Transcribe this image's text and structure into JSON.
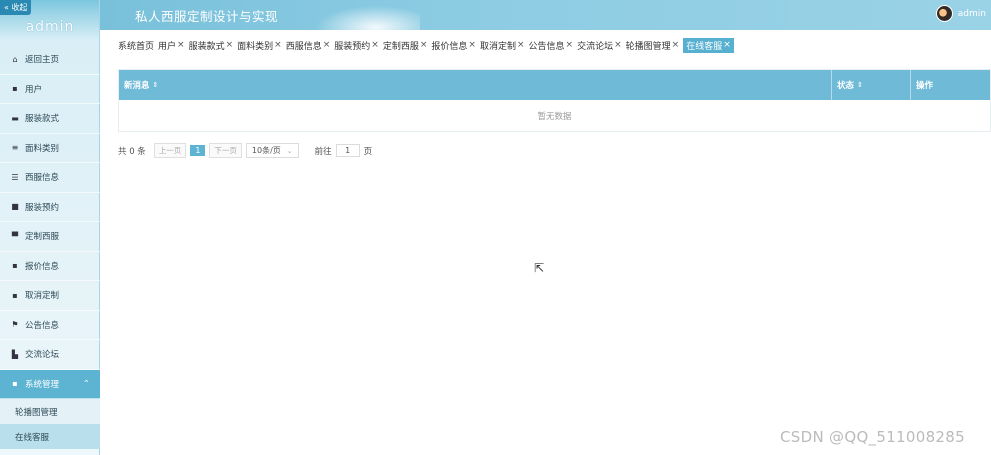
{
  "sidebar": {
    "collapse_label": "« 收起",
    "brand": "admin",
    "items": [
      {
        "label": "返回主页",
        "icon": "home-icon",
        "glyph": "⌂"
      },
      {
        "label": "用户",
        "icon": "grid-icon",
        "glyph": "▪"
      },
      {
        "label": "服装款式",
        "icon": "briefcase-icon",
        "glyph": "▬"
      },
      {
        "label": "面料类别",
        "icon": "list-icon",
        "glyph": "≡"
      },
      {
        "label": "西服信息",
        "icon": "sliders-icon",
        "glyph": "☰"
      },
      {
        "label": "服装预约",
        "icon": "card-icon",
        "glyph": "■"
      },
      {
        "label": "定制西服",
        "icon": "monitor-icon",
        "glyph": "▀"
      },
      {
        "label": "报价信息",
        "icon": "grid-icon",
        "glyph": "▪"
      },
      {
        "label": "取消定制",
        "icon": "grid-icon",
        "glyph": "▪"
      },
      {
        "label": "公告信息",
        "icon": "flag-icon",
        "glyph": "⚑"
      },
      {
        "label": "交流论坛",
        "icon": "chart-icon",
        "glyph": "▙"
      }
    ],
    "system": {
      "label": "系统管理",
      "icon": "grid-icon",
      "glyph": "▪",
      "chevron": "⌃"
    },
    "sub_items": [
      {
        "label": "轮播图管理"
      },
      {
        "label": "在线客服"
      }
    ]
  },
  "header": {
    "title": "私人西服定制设计与实现",
    "user": "admin"
  },
  "tabs": [
    {
      "label": "系统首页",
      "close": ""
    },
    {
      "label": "用户",
      "close": "×"
    },
    {
      "label": "服装款式",
      "close": "×"
    },
    {
      "label": "面料类别",
      "close": "×"
    },
    {
      "label": "西服信息",
      "close": "×"
    },
    {
      "label": "服装预约",
      "close": "×"
    },
    {
      "label": "定制西服",
      "close": "×"
    },
    {
      "label": "报价信息",
      "close": "×"
    },
    {
      "label": "取消定制",
      "close": "×"
    },
    {
      "label": "公告信息",
      "close": "×"
    },
    {
      "label": "交流论坛",
      "close": "×"
    },
    {
      "label": "轮播图管理",
      "close": "×"
    },
    {
      "label": "在线客服",
      "close": "×"
    }
  ],
  "table": {
    "columns": [
      {
        "label": "新消息",
        "sort": "⇕"
      },
      {
        "label": "状态",
        "sort": "⇕"
      },
      {
        "label": "操作",
        "sort": ""
      }
    ],
    "empty_text": "暂无数据"
  },
  "pagination": {
    "total": "共 0 条",
    "prev": "上一页",
    "current": "1",
    "next": "下一页",
    "page_size": "10条/页",
    "goto_label": "前往",
    "goto_value": "1",
    "page_unit": "页"
  },
  "watermark": "CSDN @QQ_511008285"
}
